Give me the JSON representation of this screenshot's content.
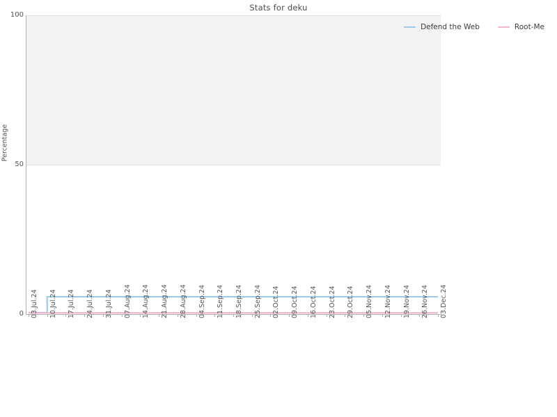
{
  "chart_data": {
    "type": "line",
    "title": "Stats for deku",
    "xlabel": "",
    "ylabel": "Percentage",
    "ylim": [
      0,
      100
    ],
    "yticks": [
      0,
      50,
      100
    ],
    "grid": true,
    "legend_position": "top-right",
    "categories": [
      "03.Jul.24",
      "10.Jul.24",
      "17.Jul.24",
      "24.Jul.24",
      "31.Jul.24",
      "07.Aug.24",
      "14.Aug.24",
      "21.Aug.24",
      "28.Aug.24",
      "04.Sep.24",
      "11.Sep.24",
      "18.Sep.24",
      "25.Sep.24",
      "02.Oct.24",
      "09.Oct.24",
      "16.Oct.24",
      "23.Oct.24",
      "29.Oct.24",
      "05.Nov.24",
      "12.Nov.24",
      "19.Nov.24",
      "26.Nov.24",
      "03.Dec.24"
    ],
    "series": [
      {
        "name": "Defend the Web",
        "color": "#9ecae8",
        "values": [
          0.5,
          5.8,
          5.8,
          5.8,
          5.8,
          5.8,
          5.8,
          5.8,
          5.8,
          5.8,
          5.8,
          5.8,
          5.8,
          5.8,
          5.8,
          5.8,
          5.8,
          5.8,
          5.8,
          5.8,
          5.8,
          5.8,
          5.8
        ]
      },
      {
        "name": "Root-Me",
        "color": "#f0b6cd",
        "values": [
          0.4,
          0.4,
          0.4,
          0.4,
          0.4,
          0.4,
          0.4,
          0.4,
          0.4,
          0.4,
          0.4,
          0.4,
          0.4,
          0.4,
          0.4,
          0.4,
          0.4,
          0.4,
          0.4,
          0.4,
          0.4,
          0.4,
          0.4
        ]
      }
    ]
  },
  "colors": {
    "defend_the_web": "#9ecae8",
    "root_me": "#f0b6cd",
    "band": "#f2f2f2",
    "axis": "#b0b0b0",
    "text": "#555555"
  }
}
